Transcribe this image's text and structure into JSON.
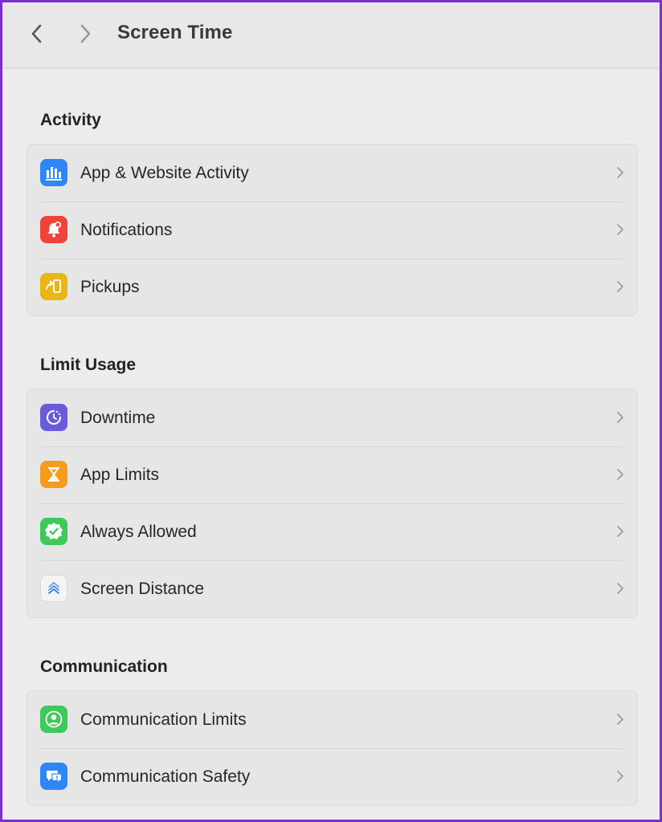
{
  "toolbar": {
    "title": "Screen Time",
    "back_icon": "chevron-left-icon",
    "forward_icon": "chevron-right-icon"
  },
  "sections": [
    {
      "title": "Activity",
      "items": [
        {
          "label": "App & Website Activity",
          "icon": "bar-chart-icon",
          "color": "#2f86f6"
        },
        {
          "label": "Notifications",
          "icon": "bell-icon",
          "color": "#f0443a"
        },
        {
          "label": "Pickups",
          "icon": "phone-pickup-icon",
          "color": "#e9b616"
        }
      ]
    },
    {
      "title": "Limit Usage",
      "items": [
        {
          "label": "Downtime",
          "icon": "moon-dial-icon",
          "color": "#6a5bd8"
        },
        {
          "label": "App Limits",
          "icon": "hourglass-icon",
          "color": "#f59b1e"
        },
        {
          "label": "Always Allowed",
          "icon": "checkmark-seal-icon",
          "color": "#3fc95a"
        },
        {
          "label": "Screen Distance",
          "icon": "distance-chevrons-icon",
          "color": "#f4f4f4"
        }
      ]
    },
    {
      "title": "Communication",
      "items": [
        {
          "label": "Communication Limits",
          "icon": "person-circle-icon",
          "color": "#3fc95a"
        },
        {
          "label": "Communication Safety",
          "icon": "chat-bubbles-icon",
          "color": "#2f86f6"
        }
      ]
    }
  ]
}
